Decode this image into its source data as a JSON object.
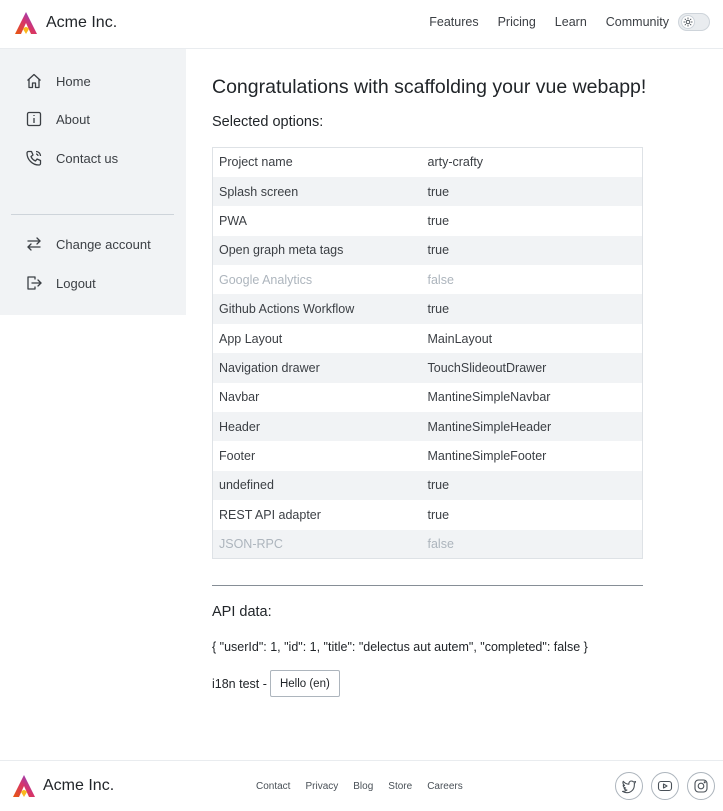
{
  "header": {
    "brand": "Acme Inc.",
    "nav": [
      "Features",
      "Pricing",
      "Learn",
      "Community"
    ],
    "theme_toggle_icon": "sun-icon"
  },
  "sidebar": {
    "items": [
      {
        "label": "Home",
        "icon": "home-icon"
      },
      {
        "label": "About",
        "icon": "info-icon"
      },
      {
        "label": "Contact us",
        "icon": "phone-icon"
      },
      {
        "label": "Change account",
        "icon": "switch-arrows-icon"
      },
      {
        "label": "Logout",
        "icon": "logout-icon"
      }
    ]
  },
  "main": {
    "title": "Congratulations with scaffolding your vue webapp!",
    "subtitle": "Selected options:",
    "options": [
      {
        "name": "Project name",
        "value": "arty-crafty",
        "disabled": false
      },
      {
        "name": "Splash screen",
        "value": "true",
        "disabled": false
      },
      {
        "name": "PWA",
        "value": "true",
        "disabled": false
      },
      {
        "name": "Open graph meta tags",
        "value": "true",
        "disabled": false
      },
      {
        "name": "Google Analytics",
        "value": "false",
        "disabled": true
      },
      {
        "name": "Github Actions Workflow",
        "value": "true",
        "disabled": false
      },
      {
        "name": "App Layout",
        "value": "MainLayout",
        "disabled": false
      },
      {
        "name": "Navigation drawer",
        "value": "TouchSlideoutDrawer",
        "disabled": false
      },
      {
        "name": "Navbar",
        "value": "MantineSimpleNavbar",
        "disabled": false
      },
      {
        "name": "Header",
        "value": "MantineSimpleHeader",
        "disabled": false
      },
      {
        "name": "Footer",
        "value": "MantineSimpleFooter",
        "disabled": false
      },
      {
        "name": "undefined",
        "value": "true",
        "disabled": false
      },
      {
        "name": "REST API adapter",
        "value": "true",
        "disabled": false
      },
      {
        "name": "JSON-RPC",
        "value": "false",
        "disabled": true
      }
    ],
    "api_title": "API data:",
    "api_json": "{ \"userId\": 1, \"id\": 1, \"title\": \"delectus aut autem\", \"completed\": false }",
    "i18n_label": "i18n test -",
    "i18n_button": "Hello (en)"
  },
  "footer": {
    "brand": "Acme Inc.",
    "links": [
      "Contact",
      "Privacy",
      "Blog",
      "Store",
      "Careers"
    ],
    "socials": [
      "twitter-icon",
      "youtube-icon",
      "instagram-icon"
    ]
  },
  "colors": {
    "brand_gradient_start": "#e8590c",
    "brand_gradient_end": "#7048e8",
    "sidebar_bg": "#f1f3f5",
    "muted_text": "#adb5bd"
  }
}
